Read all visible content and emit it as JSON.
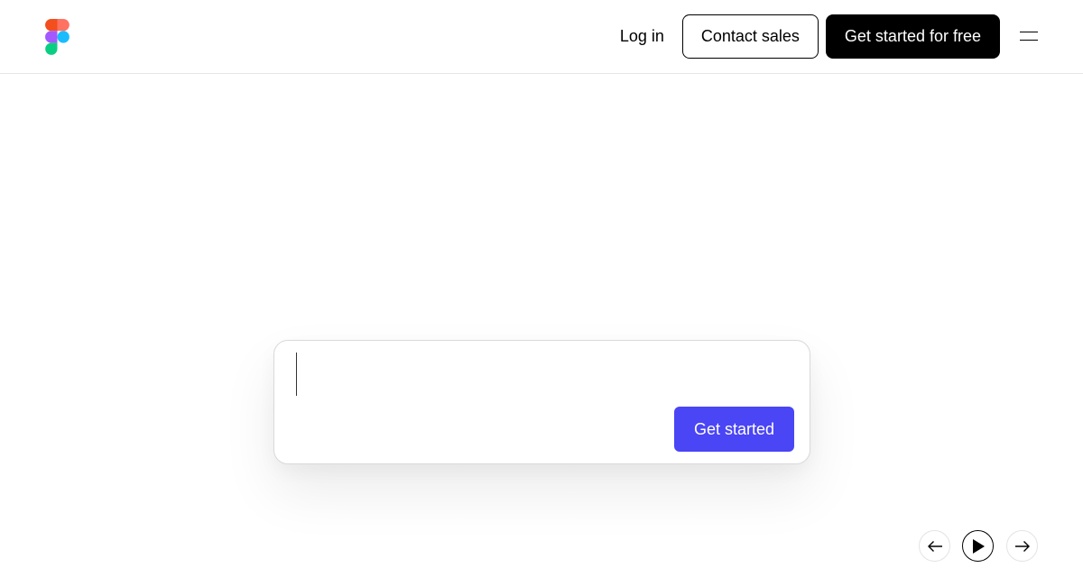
{
  "header": {
    "logo_icon": "figma-logo-icon",
    "login_label": "Log in",
    "contact_sales_label": "Contact sales",
    "get_started_free_label": "Get started for free",
    "menu_icon": "hamburger-menu-icon"
  },
  "prompt": {
    "input_value": "",
    "submit_label": "Get started",
    "accent_color": "#4a45f5"
  },
  "carousel": {
    "prev_icon": "arrow-left-icon",
    "play_icon": "play-icon",
    "next_icon": "arrow-right-icon"
  },
  "colors": {
    "logo_red": "#f24e1e",
    "logo_orange": "#ff7262",
    "logo_purple": "#a259ff",
    "logo_blue": "#1abcfe",
    "logo_green": "#0acf83"
  }
}
